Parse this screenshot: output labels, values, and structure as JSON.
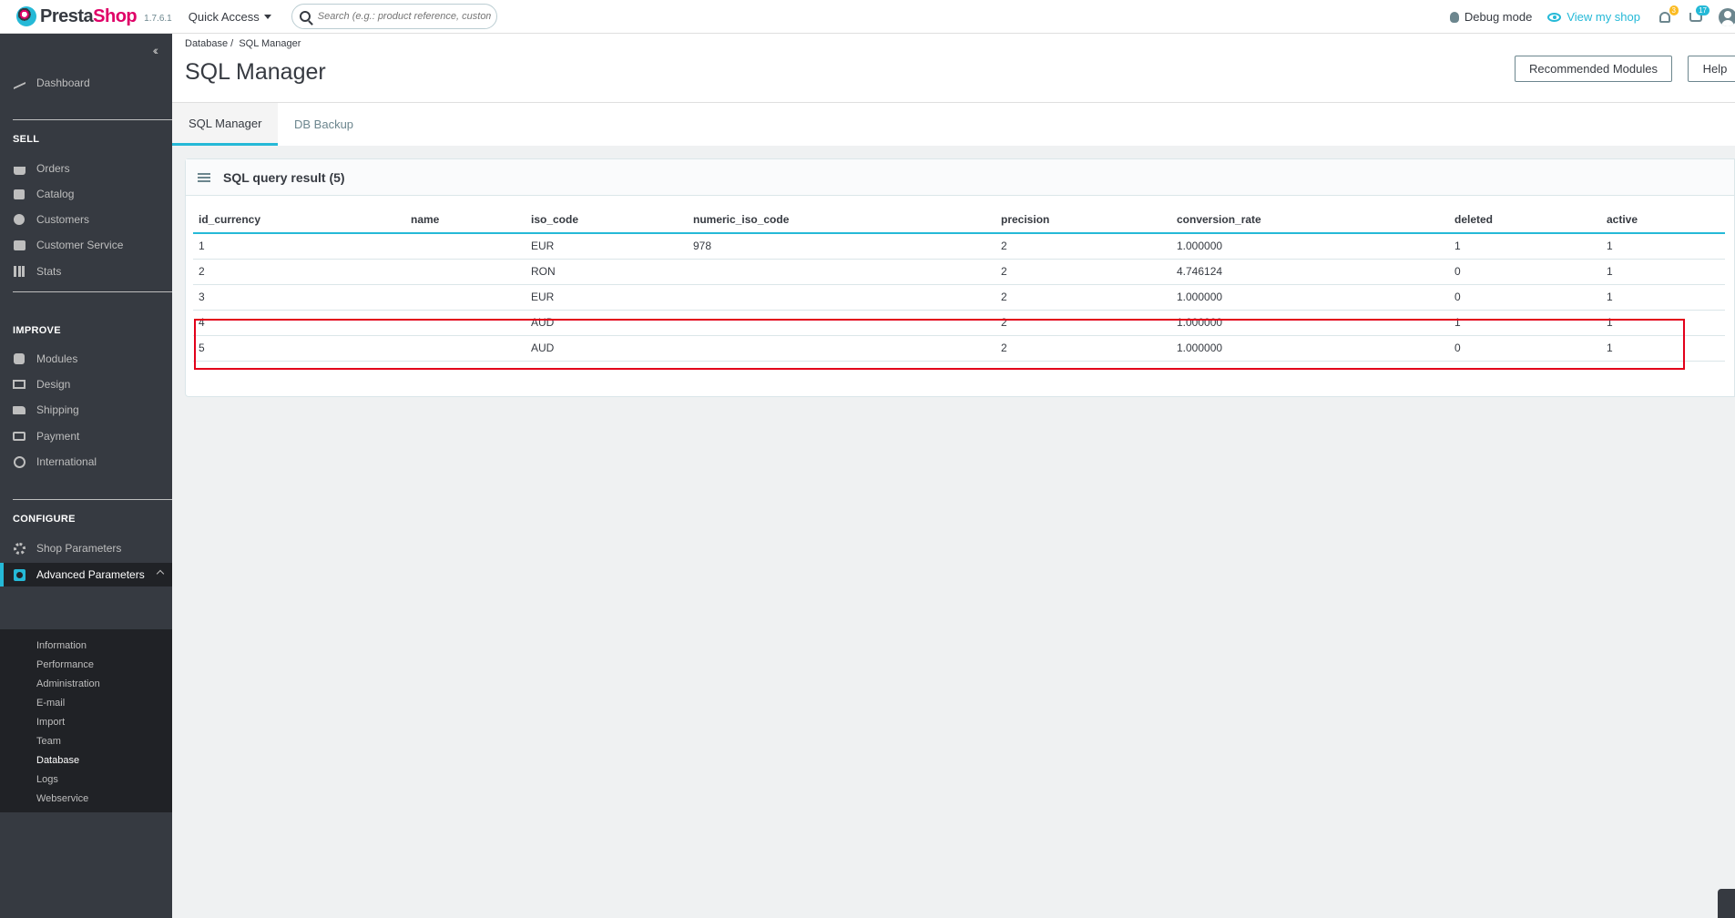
{
  "topbar": {
    "logo_text_a": "Presta",
    "logo_text_b": "Shop",
    "version": "1.7.6.1",
    "quick_access": "Quick Access",
    "search_placeholder": "Search (e.g.: product reference, customer name…)",
    "debug_mode": "Debug mode",
    "view_shop": "View my shop",
    "notif_count": "3",
    "cart_count": "17"
  },
  "sidebar": {
    "dashboard": "Dashboard",
    "sell_title": "SELL",
    "orders": "Orders",
    "catalog": "Catalog",
    "customers": "Customers",
    "customer_service": "Customer Service",
    "stats": "Stats",
    "improve_title": "IMPROVE",
    "modules": "Modules",
    "design": "Design",
    "shipping": "Shipping",
    "payment": "Payment",
    "international": "International",
    "configure_title": "CONFIGURE",
    "shop_parameters": "Shop Parameters",
    "advanced_parameters": "Advanced Parameters",
    "sub": [
      "Information",
      "Performance",
      "Administration",
      "E-mail",
      "Import",
      "Team",
      "Database",
      "Logs",
      "Webservice"
    ]
  },
  "header": {
    "breadcrumb_parent": "Database",
    "breadcrumb_current": "SQL Manager",
    "title": "SQL Manager",
    "recommended_modules": "Recommended Modules",
    "help": "Help"
  },
  "tabs": {
    "sql_manager": "SQL Manager",
    "db_backup": "DB Backup"
  },
  "panel": {
    "title": "SQL query result (5)",
    "columns": [
      "id_currency",
      "name",
      "iso_code",
      "numeric_iso_code",
      "precision",
      "conversion_rate",
      "deleted",
      "active"
    ],
    "rows": [
      [
        "1",
        "",
        "EUR",
        "978",
        "2",
        "1.000000",
        "1",
        "1"
      ],
      [
        "2",
        "",
        "RON",
        "",
        "2",
        "4.746124",
        "0",
        "1"
      ],
      [
        "3",
        "",
        "EUR",
        "",
        "2",
        "1.000000",
        "0",
        "1"
      ],
      [
        "4",
        "",
        "AUD",
        "",
        "2",
        "1.000000",
        "1",
        "1"
      ],
      [
        "5",
        "",
        "AUD",
        "",
        "2",
        "1.000000",
        "0",
        "1"
      ]
    ]
  },
  "colors": {
    "accent": "#25b9d7",
    "brand_pink": "#df0067",
    "sidebar_bg": "#363a41",
    "highlight_red": "#e2001a"
  }
}
